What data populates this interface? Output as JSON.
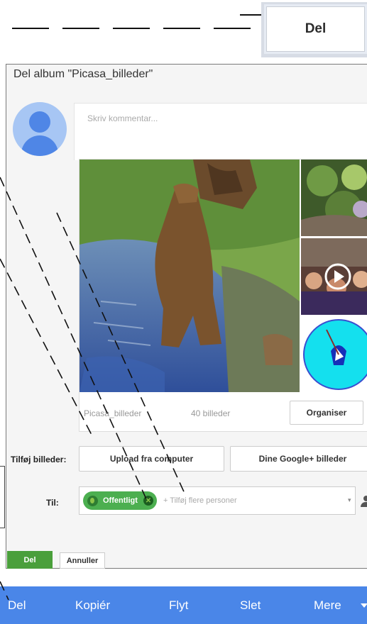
{
  "header": {
    "share_button_label": "Del"
  },
  "dialog": {
    "title": "Del album \"Picasa_billeder\"",
    "comment_placeholder": "Skriv kommentar...",
    "album": {
      "name": "Picasa_billeder",
      "photo_count": "40 billeder",
      "organise_label": "Organiser"
    },
    "add_photos": {
      "label": "Tilføj billeder:",
      "upload_label": "Upload fra computer",
      "gplus_label": "Dine Google+ billeder"
    },
    "to": {
      "label": "Til:",
      "chip_label": "Offentligt",
      "add_people_placeholder": "+ Tilføj flere personer"
    },
    "share_label": "Del",
    "cancel_label": "Annuller"
  },
  "action_bar": {
    "items": [
      "Del",
      "Kopiér",
      "Flyt",
      "Slet",
      "Mere"
    ]
  },
  "colors": {
    "action_bar": "#4a86e8",
    "share_green": "#4a9f3b",
    "chip_green": "#4caf50"
  },
  "icons": [
    "avatar-icon",
    "globe-icon",
    "remove-icon",
    "play-icon",
    "person-icon",
    "chevron-down-icon"
  ]
}
